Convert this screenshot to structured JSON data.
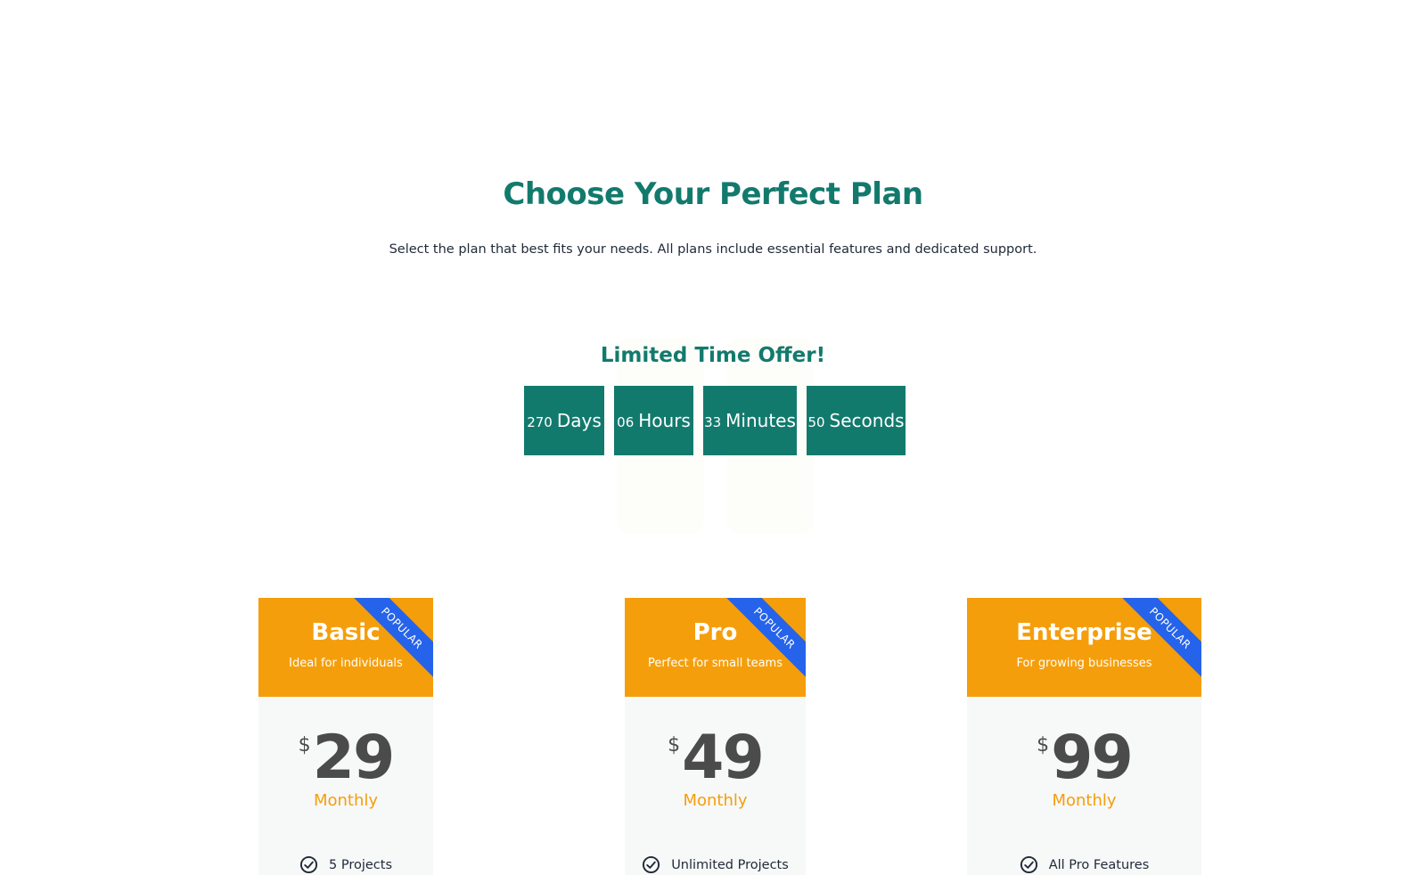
{
  "header": {
    "title": "Choose Your Perfect Plan",
    "subtitle": "Select the plan that best fits your needs. All plans include essential features and dedicated support."
  },
  "offer": {
    "title": "Limited Time Offer!",
    "countdown": [
      {
        "value": "270",
        "unit": "Days"
      },
      {
        "value": "06",
        "unit": "Hours"
      },
      {
        "value": "33",
        "unit": "Minutes"
      },
      {
        "value": "50",
        "unit": "Seconds"
      }
    ]
  },
  "plans": [
    {
      "name": "Basic",
      "description": "Ideal for individuals",
      "badge": "POPULAR",
      "currency": "$",
      "price": "29",
      "period": "Monthly",
      "first_feature": "5 Projects"
    },
    {
      "name": "Pro",
      "description": "Perfect for small teams",
      "badge": "POPULAR",
      "currency": "$",
      "price": "49",
      "period": "Monthly",
      "first_feature": "Unlimited Projects"
    },
    {
      "name": "Enterprise",
      "description": "For growing businesses",
      "badge": "POPULAR",
      "currency": "$",
      "price": "99",
      "period": "Monthly",
      "first_feature": "All Pro Features"
    }
  ],
  "colors": {
    "primary": "#127a6d",
    "accent": "#f59e0b",
    "badge": "#2563eb",
    "card_body": "#f7f8f8"
  }
}
